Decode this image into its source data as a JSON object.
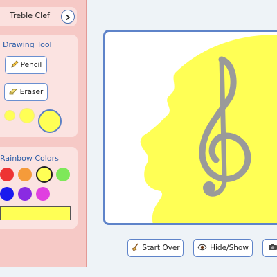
{
  "header": {
    "title": "Treble Clef"
  },
  "drawing_tool": {
    "title": "Drawing Tool",
    "pencil_label": "Pencil",
    "eraser_label": "Eraser",
    "selected_tool": "eraser",
    "selected_size": "large"
  },
  "rainbow": {
    "title": "Rainbow Colors",
    "swatches": [
      "#ee3333",
      "#f59b3a",
      "#ffff55",
      "#7ee85a",
      "#1a1aee",
      "#8a2be2",
      "#e040e0"
    ],
    "selected": "#ffff55"
  },
  "canvas": {
    "symbol": "treble-clef",
    "scribble_color": "#ffff55",
    "symbol_color": "#9a9a9a"
  },
  "buttons": {
    "start_over": "Start Over",
    "hide_show": "Hide/Show"
  },
  "colors": {
    "accent": "#5e83c9",
    "sidebar": "#f6c9c6"
  }
}
